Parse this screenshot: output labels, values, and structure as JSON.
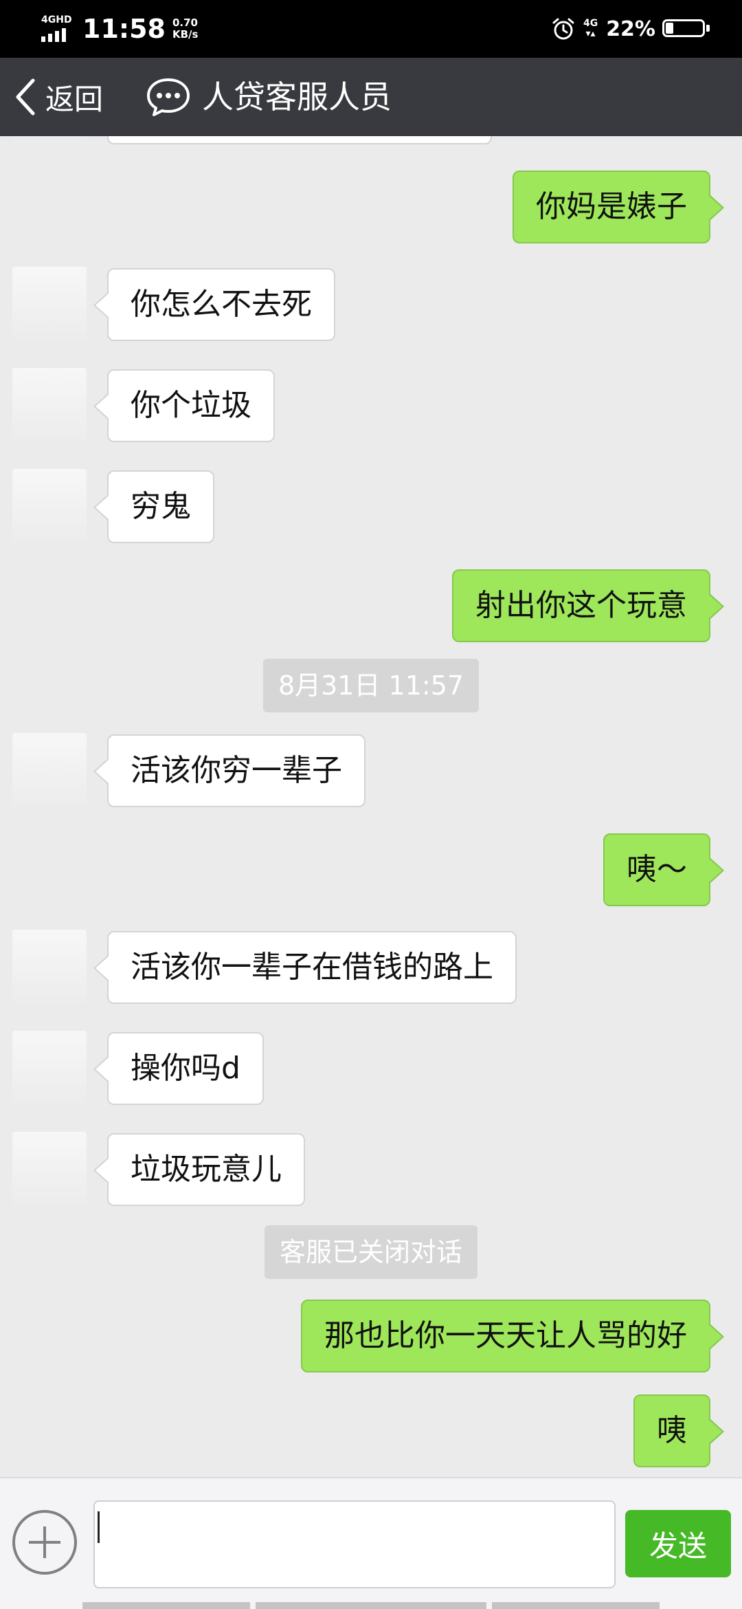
{
  "status_bar": {
    "network": "4GHD",
    "time": "11:58",
    "speed_value": "0.70",
    "speed_unit": "KB/s",
    "network_right": "4G",
    "battery_percent": "22%",
    "battery_level": 0.22
  },
  "nav": {
    "back_label": "返回",
    "title": "人贷客服人员"
  },
  "messages": [
    {
      "side": "out",
      "text": "你妈是婊子"
    },
    {
      "side": "in",
      "text": "你怎么不去死"
    },
    {
      "side": "in",
      "text": "你个垃圾"
    },
    {
      "side": "in",
      "text": "穷鬼"
    },
    {
      "side": "out",
      "text": "射出你这个玩意"
    },
    {
      "side": "system",
      "text": "8月31日 11:57"
    },
    {
      "side": "in",
      "text": "活该你穷一辈子"
    },
    {
      "side": "out",
      "text": "咦～"
    },
    {
      "side": "in",
      "text": "活该你一辈子在借钱的路上"
    },
    {
      "side": "in",
      "text": "操你吗d"
    },
    {
      "side": "in",
      "text": "垃圾玩意儿"
    },
    {
      "side": "system",
      "text": "客服已关闭对话"
    },
    {
      "side": "out",
      "text": "那也比你一天天让人骂的好"
    },
    {
      "side": "out",
      "text": "咦"
    }
  ],
  "input": {
    "value": "",
    "send_label": "发送"
  },
  "colors": {
    "status_bar": "#000000",
    "nav_bar": "#393a3f",
    "chat_background": "#ebebeb",
    "outgoing_bubble": "#9ee65a",
    "incoming_bubble": "#ffffff",
    "send_button": "#46b927"
  }
}
